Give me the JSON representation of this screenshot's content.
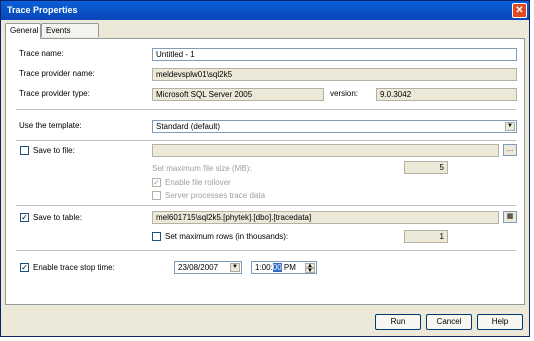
{
  "window": {
    "title": "Trace Properties",
    "close_glyph": "✕"
  },
  "tabs": [
    {
      "label": "General"
    },
    {
      "label": "Events Selection"
    }
  ],
  "general": {
    "trace_name_label": "Trace name:",
    "trace_name_value": "Untitled - 1",
    "provider_name_label": "Trace provider name:",
    "provider_name_value": "meldevsplw01\\sql2k5",
    "provider_type_label": "Trace provider type:",
    "provider_type_value": "Microsoft SQL Server 2005",
    "version_label": "version:",
    "version_value": "9.0.3042",
    "template_label": "Use the template:",
    "template_value": "Standard (default)",
    "save_file_label": "Save to file:",
    "max_file_size_label": "Set maximum file size (MB):",
    "max_file_size_value": "5",
    "enable_rollover_label": "Enable file rollover",
    "server_processes_label": "Server processes trace data",
    "save_table_label": "Save to table:",
    "save_table_value": "mel601715\\sql2k5.[phytek].[dbo].[tracedata]",
    "max_rows_label": "Set maximum rows (in thousands):",
    "max_rows_value": "1",
    "stop_time_label": "Enable trace stop time:",
    "stop_date": "23/08/2007",
    "stop_time_prefix": "1:00:",
    "stop_time_selected": "00",
    "stop_time_suffix": " PM"
  },
  "buttons": {
    "run": "Run",
    "cancel": "Cancel",
    "help": "Help"
  }
}
